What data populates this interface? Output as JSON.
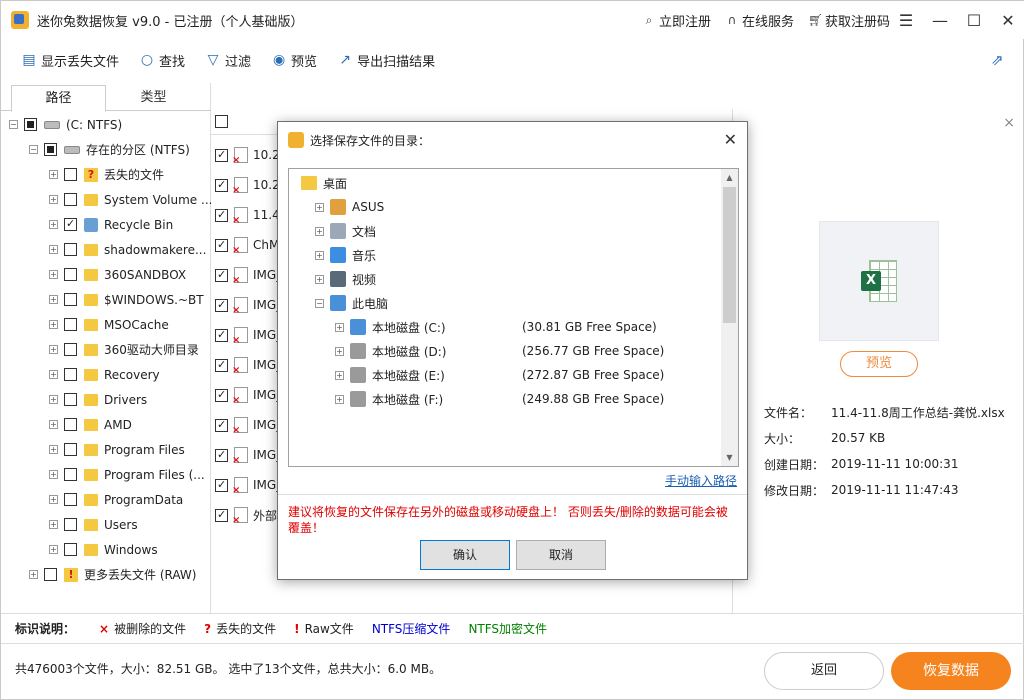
{
  "window": {
    "title": "迷你兔数据恢复  v9.0 - 已注册（个人基础版）",
    "links": [
      {
        "icon": "search-icon",
        "label": "立即注册"
      },
      {
        "icon": "headset-icon",
        "label": "在线服务"
      },
      {
        "icon": "cart-icon",
        "label": "获取注册码"
      }
    ]
  },
  "toolbar": {
    "show_lost": "显示丢失文件",
    "find": "查找",
    "filter": "过滤",
    "preview": "预览",
    "export": "导出扫描结果"
  },
  "tabs": {
    "path": "路径",
    "type": "类型"
  },
  "tree": [
    {
      "label": "(C: NTFS)",
      "level": 0,
      "icon": "drive",
      "check": "partial"
    },
    {
      "label": "存在的分区 (NTFS)",
      "level": 1,
      "icon": "drive",
      "check": "partial"
    },
    {
      "label": "丢失的文件",
      "level": 2,
      "icon": "lost",
      "check": ""
    },
    {
      "label": "System Volume ...",
      "level": 2,
      "icon": "folder",
      "check": ""
    },
    {
      "label": "Recycle Bin",
      "level": 2,
      "icon": "recycle",
      "check": "checked"
    },
    {
      "label": "shadowmakere...",
      "level": 2,
      "icon": "folder",
      "check": ""
    },
    {
      "label": "360SANDBOX",
      "level": 2,
      "icon": "folder",
      "check": ""
    },
    {
      "label": "$WINDOWS.~BT",
      "level": 2,
      "icon": "folder",
      "check": ""
    },
    {
      "label": "MSOCache",
      "level": 2,
      "icon": "folder",
      "check": ""
    },
    {
      "label": "360驱动大师目录",
      "level": 2,
      "icon": "folder",
      "check": ""
    },
    {
      "label": "Recovery",
      "level": 2,
      "icon": "folder",
      "check": ""
    },
    {
      "label": "Drivers",
      "level": 2,
      "icon": "folder",
      "check": ""
    },
    {
      "label": "AMD",
      "level": 2,
      "icon": "folder",
      "check": ""
    },
    {
      "label": "Program Files",
      "level": 2,
      "icon": "folder",
      "check": ""
    },
    {
      "label": "Program Files (...",
      "level": 2,
      "icon": "folder",
      "check": ""
    },
    {
      "label": "ProgramData",
      "level": 2,
      "icon": "folder",
      "check": ""
    },
    {
      "label": "Users",
      "level": 2,
      "icon": "folder",
      "check": ""
    },
    {
      "label": "Windows",
      "level": 2,
      "icon": "folder",
      "check": ""
    },
    {
      "label": "更多丢失文件 (RAW)",
      "level": 1,
      "icon": "lost",
      "check": ""
    }
  ],
  "file_rows": [
    "10.2",
    "10.2",
    "11.4",
    "ChM",
    "IMG_",
    "IMG_",
    "IMG_",
    "IMG_",
    "IMG_",
    "IMG_",
    "IMG_",
    "IMG_",
    "外部"
  ],
  "details": {
    "preview_btn": "预览",
    "rows": [
      {
        "key": "文件名：",
        "value": "11.4-11.8周工作总结-龚悦.xlsx"
      },
      {
        "key": "大小：",
        "value": "20.57 KB"
      },
      {
        "key": "创建日期：",
        "value": "2019-11-11 10:00:31"
      },
      {
        "key": "修改日期：",
        "value": "2019-11-11 11:47:43"
      }
    ]
  },
  "legend": {
    "title": "标识说明：",
    "items": [
      {
        "mark": "×",
        "color": "#e00000",
        "label": "被删除的文件",
        "label_color": "#222222"
      },
      {
        "mark": "?",
        "color": "#e00000",
        "label": "丢失的文件",
        "label_color": "#222222"
      },
      {
        "mark": "!",
        "color": "#e00000",
        "label": "Raw文件",
        "label_color": "#222222"
      },
      {
        "mark": "",
        "color": "#0000cc",
        "label": "NTFS压缩文件",
        "label_color": "#0000cc"
      },
      {
        "mark": "",
        "color": "#008000",
        "label": "NTFS加密文件",
        "label_color": "#008000"
      }
    ]
  },
  "status": {
    "text": "共476003个文件，大小：82.51 GB。 选中了13个文件，总共大小：6.0 MB。",
    "back": "返回",
    "recover": "恢复数据"
  },
  "dialog": {
    "title": "选择保存文件的目录：",
    "tree": [
      {
        "label": "桌面",
        "indent": 0,
        "expander": "",
        "icon": "desktop",
        "free": ""
      },
      {
        "label": "ASUS",
        "indent": 1,
        "expander": "+",
        "icon": "user",
        "free": ""
      },
      {
        "label": "文档",
        "indent": 1,
        "expander": "+",
        "icon": "docs",
        "free": ""
      },
      {
        "label": "音乐",
        "indent": 1,
        "expander": "+",
        "icon": "music",
        "free": ""
      },
      {
        "label": "视频",
        "indent": 1,
        "expander": "+",
        "icon": "video",
        "free": ""
      },
      {
        "label": "此电脑",
        "indent": 1,
        "expander": "-",
        "icon": "pc",
        "free": ""
      },
      {
        "label": "本地磁盘 (C:)",
        "indent": 2,
        "expander": "+",
        "icon": "sysdrive",
        "free": "(30.81 GB Free Space)"
      },
      {
        "label": "本地磁盘 (D:)",
        "indent": 2,
        "expander": "+",
        "icon": "drive",
        "free": "(256.77 GB Free Space)"
      },
      {
        "label": "本地磁盘 (E:)",
        "indent": 2,
        "expander": "+",
        "icon": "drive",
        "free": "(272.87 GB Free Space)"
      },
      {
        "label": "本地磁盘 (F:)",
        "indent": 2,
        "expander": "+",
        "icon": "drive",
        "free": "(249.88 GB Free Space)"
      }
    ],
    "manual_link": "手动输入路径",
    "warning": "建议将恢复的文件保存在另外的磁盘或移动硬盘上！ 否则丢失/删除的数据可能会被覆盖！",
    "ok": "确认",
    "cancel": "取消"
  }
}
